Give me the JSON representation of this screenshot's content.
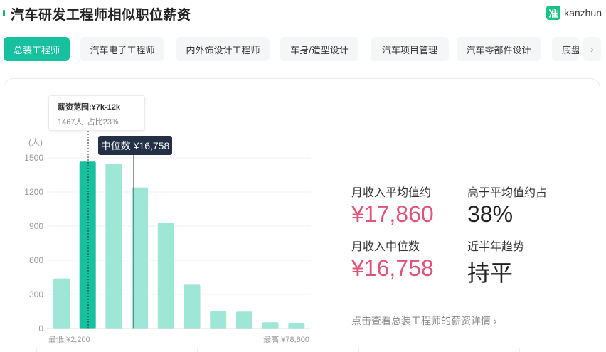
{
  "header": {
    "title": "汽车研发工程师相似职位薪资",
    "brand_icon_glyph": "准",
    "brand_name": "kanzhun"
  },
  "tabs": [
    {
      "label": "总装工程师",
      "active": true
    },
    {
      "label": "汽车电子工程师",
      "active": false
    },
    {
      "label": "内外饰设计工程师",
      "active": false
    },
    {
      "label": "车身/造型设计",
      "active": false
    },
    {
      "label": "汽车项目管理",
      "active": false
    },
    {
      "label": "汽车零部件设计",
      "active": false
    },
    {
      "label": "底盘",
      "active": false
    }
  ],
  "tooltip": {
    "range_label": "薪资范围:¥7k-12k",
    "count_label": "1467人",
    "share_label": "占比23%"
  },
  "median_badge": "中位数 ¥16,758",
  "stats": {
    "avg_label": "月收入平均值约",
    "avg_value": "¥17,860",
    "above_avg_label": "高于平均值约占",
    "above_avg_value": "38%",
    "median_label": "月收入中位数",
    "median_value": "¥16,758",
    "trend_label": "近半年趋势",
    "trend_value": "持平"
  },
  "detail_link": "点击查看总装工程师的薪资详情",
  "colors": {
    "bar": "#9ee6d6",
    "bar_highlight": "#17c09f",
    "accent": "#17c09f",
    "value_red": "#e0537a",
    "badge_bg": "#233045"
  },
  "chart_data": {
    "type": "bar",
    "yunit": "(人)",
    "ylim": [
      0,
      1500
    ],
    "yticks": [
      0,
      300,
      600,
      900,
      1200,
      1500
    ],
    "values": [
      440,
      1467,
      1450,
      1240,
      930,
      385,
      155,
      148,
      55,
      50
    ],
    "highlight_index": 1,
    "min_label": "最低:¥2,200",
    "max_label": "最高:¥78,800",
    "grid": true,
    "legend": "none"
  }
}
